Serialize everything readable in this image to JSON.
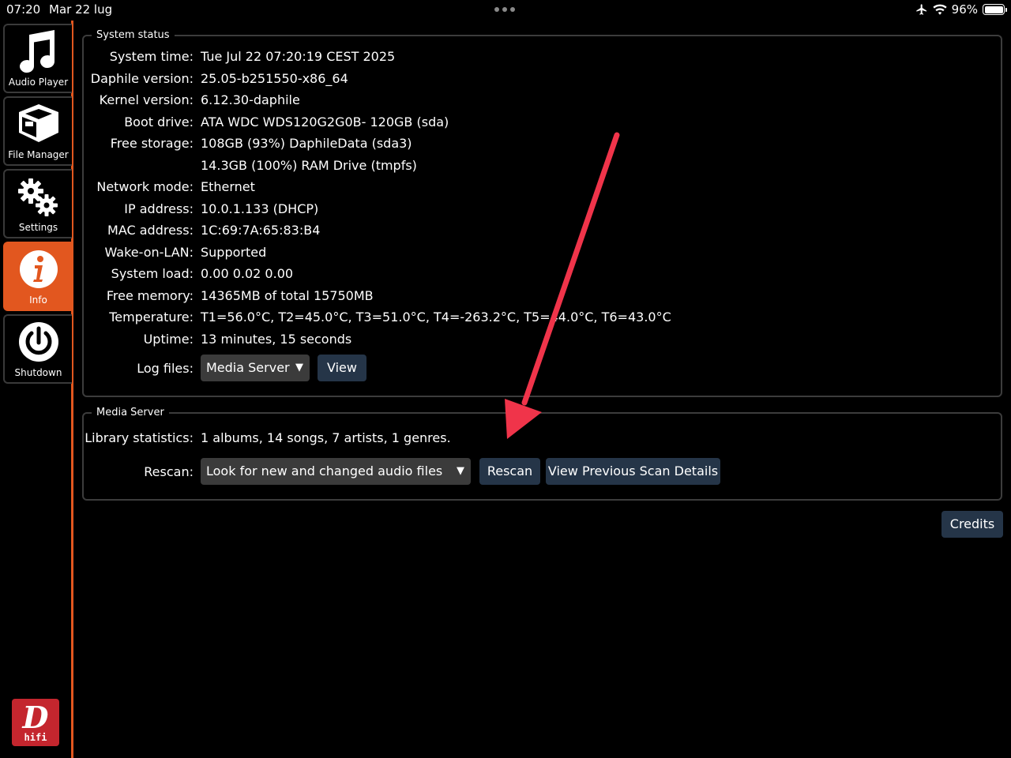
{
  "status_bar": {
    "time": "07:20",
    "date": "Mar 22 lug",
    "battery": "96%",
    "icons": [
      "airplane-icon",
      "wifi-icon",
      "battery-icon"
    ]
  },
  "sidebar": {
    "items": [
      {
        "label": "Audio Player",
        "icon": "music-note-icon"
      },
      {
        "label": "File Manager",
        "icon": "box-icon"
      },
      {
        "label": "Settings",
        "icon": "gears-icon"
      },
      {
        "label": "Info",
        "icon": "info-icon",
        "active": true
      },
      {
        "label": "Shutdown",
        "icon": "power-icon"
      }
    ],
    "logo_text": "hifi",
    "logo_letter": "D"
  },
  "system_status": {
    "legend": "System status",
    "rows": [
      {
        "label": "System time:",
        "value": "Tue Jul 22 07:20:19 CEST 2025"
      },
      {
        "label": "Daphile version:",
        "value": "25.05-b251550-x86_64"
      },
      {
        "label": "Kernel version:",
        "value": "6.12.30-daphile"
      },
      {
        "label": "Boot drive:",
        "value": "ATA WDC WDS120G2G0B- 120GB (sda)"
      },
      {
        "label": "Free storage:",
        "value": "108GB (93%) DaphileData (sda3)"
      },
      {
        "label": "",
        "value": "14.3GB (100%) RAM Drive (tmpfs)"
      },
      {
        "label": "Network mode:",
        "value": "Ethernet"
      },
      {
        "label": "IP address:",
        "value": "10.0.1.133 (DHCP)"
      },
      {
        "label": "MAC address:",
        "value": "1C:69:7A:65:83:B4"
      },
      {
        "label": "Wake-on-LAN:",
        "value": "Supported"
      },
      {
        "label": "System load:",
        "value": "0.00 0.02 0.00"
      },
      {
        "label": "Free memory:",
        "value": "14365MB of total 15750MB"
      },
      {
        "label": "Temperature:",
        "value": "T1=56.0°C, T2=45.0°C, T3=51.0°C, T4=-263.2°C, T5=44.0°C, T6=43.0°C"
      },
      {
        "label": "Uptime:",
        "value": "13 minutes, 15 seconds"
      }
    ],
    "log_files_label": "Log files:",
    "log_select_value": "Media Server",
    "view_button": "View"
  },
  "media_server": {
    "legend": "Media Server",
    "library_label": "Library statistics:",
    "library_value": "1 albums, 14 songs, 7 artists, 1 genres.",
    "rescan_label": "Rescan:",
    "rescan_select_value": "Look for new and changed audio files",
    "rescan_button": "Rescan",
    "view_details_button": "View Previous Scan Details"
  },
  "credits_button": "Credits",
  "colors": {
    "accent": "#e2571f",
    "button_bg": "#253548",
    "select_bg": "#3b3b3b",
    "annotation_arrow": "#f0344a"
  }
}
